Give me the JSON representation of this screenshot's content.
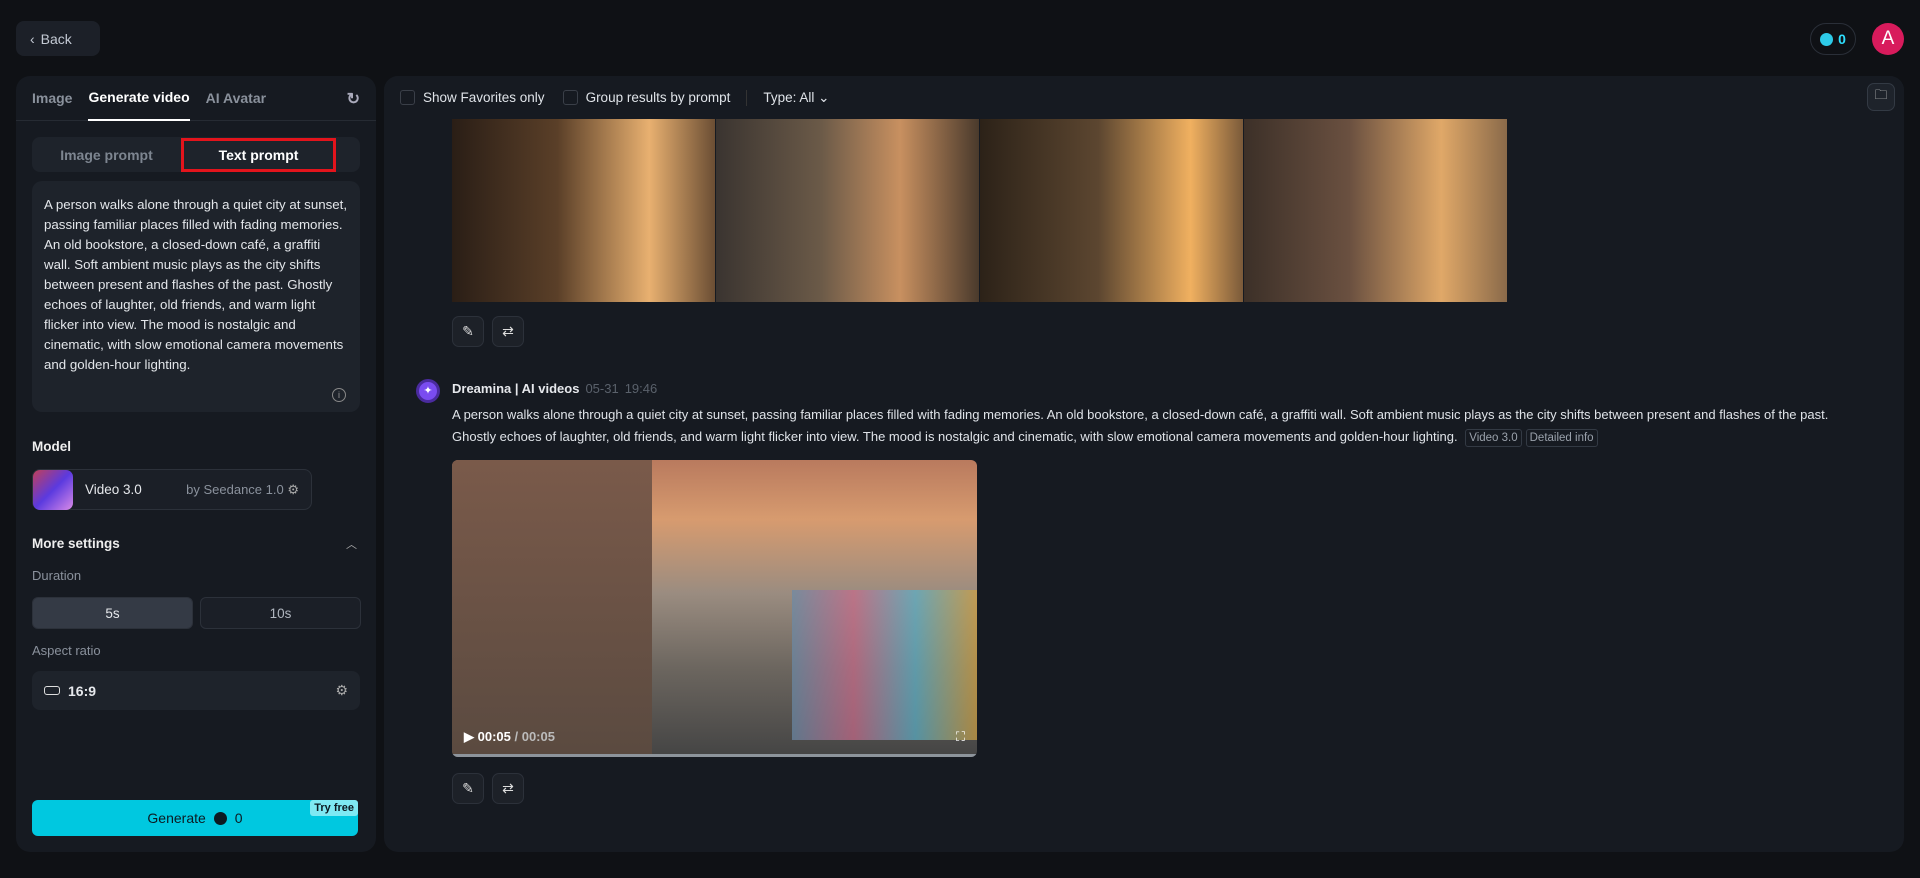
{
  "header": {
    "back_label": "Back",
    "credits": "0",
    "avatar_letter": "A"
  },
  "left": {
    "tabs": [
      "Image",
      "Generate video",
      "AI Avatar"
    ],
    "prompt_modes": [
      "Image prompt",
      "Text prompt"
    ],
    "prompt_text": "A person walks alone through a quiet city at sunset, passing familiar places filled with fading memories. An old bookstore, a closed-down café, a graffiti wall. Soft ambient music plays as the city shifts between present and flashes of the past. Ghostly echoes of laughter, old friends, and warm light flicker into view. The mood is nostalgic and cinematic, with slow emotional camera movements and golden-hour lighting.",
    "model_label": "Model",
    "model_name": "Video 3.0",
    "model_by": "by Seedance 1.0",
    "more_settings": "More settings",
    "duration_label": "Duration",
    "durations": [
      "5s",
      "10s"
    ],
    "aspect_label": "Aspect ratio",
    "aspect_value": "16:9",
    "generate_label": "Generate",
    "generate_cost": "0",
    "try_free": "Try free"
  },
  "right": {
    "filters": {
      "favorites": "Show Favorites only",
      "group": "Group results by prompt",
      "type": "Type: All"
    },
    "message": {
      "author": "Dreamina | AI videos",
      "date": "05-31",
      "time": "19:46",
      "text": "A person walks alone through a quiet city at sunset, passing familiar places filled with fading memories. An old bookstore, a closed-down café, a graffiti wall. Soft ambient music plays as the city shifts between present and flashes of the past. Ghostly echoes of laughter, old friends, and warm light flicker into view. The mood is nostalgic and cinematic, with slow emotional camera movements and golden-hour lighting.",
      "chips": [
        "Video 3.0",
        "Detailed info"
      ],
      "video_current": "00:05",
      "video_total": "/ 00:05",
      "progress": 1.0
    }
  }
}
